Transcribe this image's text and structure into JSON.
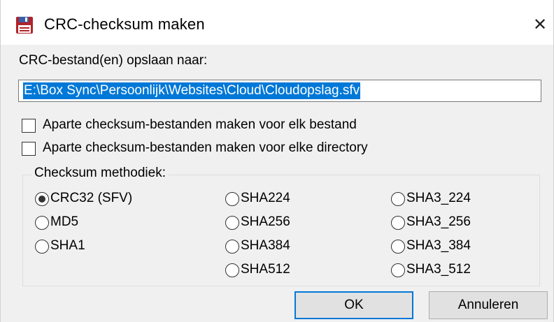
{
  "window": {
    "title": "CRC-checksum maken",
    "close_glyph": "✕"
  },
  "save": {
    "label": "CRC-bestand(en) opslaan naar:",
    "path_value": "E:\\Box Sync\\Persoonlijk\\Websites\\Cloud\\Cloudopslag.sfv"
  },
  "options": {
    "per_file_label": "Aparte checksum-bestanden maken voor elk bestand",
    "per_file_checked": false,
    "per_directory_label": "Aparte checksum-bestanden maken voor elke directory",
    "per_directory_checked": false
  },
  "method": {
    "group_label": "Checksum methodiek:",
    "selected": "CRC32 (SFV)",
    "options": {
      "crc32": "CRC32 (SFV)",
      "md5": "MD5",
      "sha1": "SHA1",
      "sha224": "SHA224",
      "sha256": "SHA256",
      "sha384": "SHA384",
      "sha512": "SHA512",
      "sha3_224": "SHA3_224",
      "sha3_256": "SHA3_256",
      "sha3_384": "SHA3_384",
      "sha3_512": "SHA3_512"
    }
  },
  "buttons": {
    "ok_label": "OK",
    "cancel_label": "Annuleren"
  },
  "icons": {
    "title_icon": "floppy-disk-icon",
    "close_icon": "close-icon"
  },
  "colors": {
    "selection": "#0078d7",
    "dialog_bg": "#f0f0f0",
    "title_icon_main": "#b0232a",
    "title_icon_label": "#3a5fa8"
  }
}
